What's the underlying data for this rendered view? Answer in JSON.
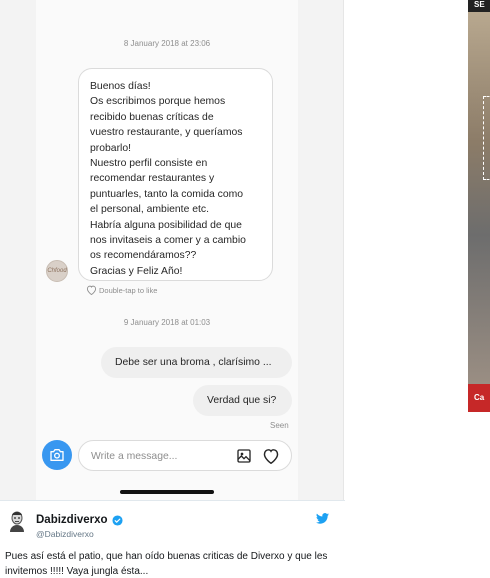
{
  "chat": {
    "timestamp_first": "8 January 2018 at 23:06",
    "incoming_lines": [
      "Buenos días!",
      "Os escribimos porque hemos",
      "recibido buenas críticas de",
      "vuestro restaurante, y queríamos",
      "probarlo!",
      "Nuestro perfil consiste en",
      "recomendar restaurantes y",
      "puntuarles, tanto la comida como",
      "el personal, ambiente etc.",
      "Habría alguna posibilidad de que",
      "nos invitaseis a comer y a cambio",
      "os recomendáramos??",
      "Gracias y Feliz Año!"
    ],
    "sender_avatar_text": "Chfood",
    "double_tap_label": "Double-tap to like",
    "timestamp_second": "9 January 2018 at 01:03",
    "outgoing_messages": [
      "Debe ser una broma , clarísimo ...",
      "Verdad que si?"
    ],
    "seen_label": "Seen",
    "composer_placeholder": "Write a message...",
    "accent_color": "#3897f0"
  },
  "media_card": {
    "top_label": "SE",
    "bottom_label": "Ca"
  },
  "tweet": {
    "display_name": "Dabizdiverxo",
    "handle": "@Dabizdiverxo",
    "text": "Pues así está el patio, que han oído buenas criticas de Diverxo y que les invitemos !!!!! Vaya jungla ésta...",
    "brand_color": "#1da1f2"
  }
}
